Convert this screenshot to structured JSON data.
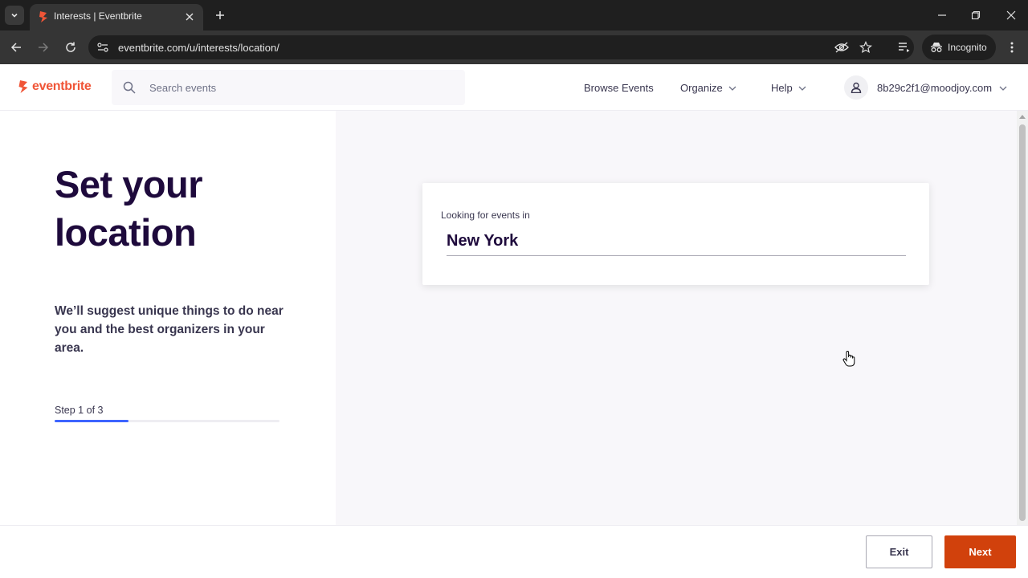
{
  "browser": {
    "tab_title": "Interests | Eventbrite",
    "url": "eventbrite.com/u/interests/location/",
    "incognito_label": "Incognito"
  },
  "header": {
    "logo_text": "eventbrite",
    "search_placeholder": "Search events",
    "nav": {
      "browse": "Browse Events",
      "organize": "Organize",
      "help": "Help"
    },
    "user_email": "8b29c2f1@moodjoy.com"
  },
  "main": {
    "title_line1": "Set your",
    "title_line2": "location",
    "subtitle": "We’ll suggest unique things to do near you and the best organizers in your area.",
    "step_label": "Step 1 of 3",
    "progress": 0.33,
    "card": {
      "label": "Looking for events in",
      "location_value": "New York"
    }
  },
  "footer": {
    "exit_label": "Exit",
    "next_label": "Next"
  },
  "colors": {
    "brand": "#f05537",
    "next_button": "#d1410c",
    "progress": "#3d64ff",
    "heading": "#1e0a3c"
  }
}
